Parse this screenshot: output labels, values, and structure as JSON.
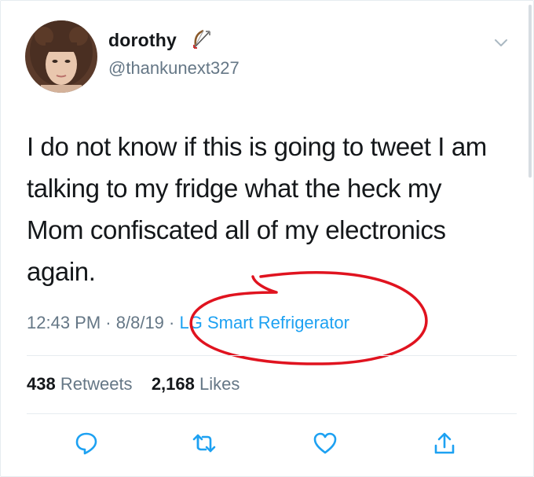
{
  "author": {
    "display_name": "dorothy",
    "name_emoji": "bow-and-arrow-icon",
    "handle": "@thankunext327"
  },
  "tweet": {
    "text": "I do not know if this is going to tweet I am talking to my fridge what the heck my Mom confiscated all of my electronics again.",
    "time": "12:43 PM",
    "date": "8/8/19",
    "source": "LG Smart Refrigerator"
  },
  "stats": {
    "retweets_count": "438",
    "retweets_label": "Retweets",
    "likes_count": "2,168",
    "likes_label": "Likes"
  },
  "actions": [
    "reply-icon",
    "retweet-icon",
    "like-icon",
    "share-icon"
  ],
  "colors": {
    "text": "#14171a",
    "secondary": "#657786",
    "link": "#1da1f2",
    "annotation": "#e0131f",
    "divider": "#e6ecf0"
  }
}
